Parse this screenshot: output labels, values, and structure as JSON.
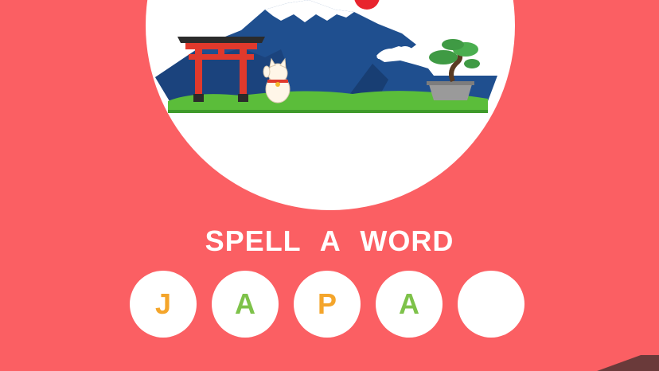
{
  "prompt": {
    "text": "SPELL A WORD"
  },
  "colors": {
    "background": "#fb5f63",
    "slot_background": "#ffffff",
    "prompt_text": "#ffffff"
  },
  "word_slots": [
    {
      "letter": "J",
      "color": "#f4a52b"
    },
    {
      "letter": "A",
      "color": "#7ec24a"
    },
    {
      "letter": "P",
      "color": "#f4a52b"
    },
    {
      "letter": "A",
      "color": "#7ec24a"
    },
    {
      "letter": "",
      "color": "#ffffff"
    }
  ],
  "illustration": {
    "icons": [
      "mount-fuji-icon",
      "torii-gate-icon",
      "lucky-cat-icon",
      "bonsai-tree-icon",
      "rising-sun-icon"
    ]
  }
}
